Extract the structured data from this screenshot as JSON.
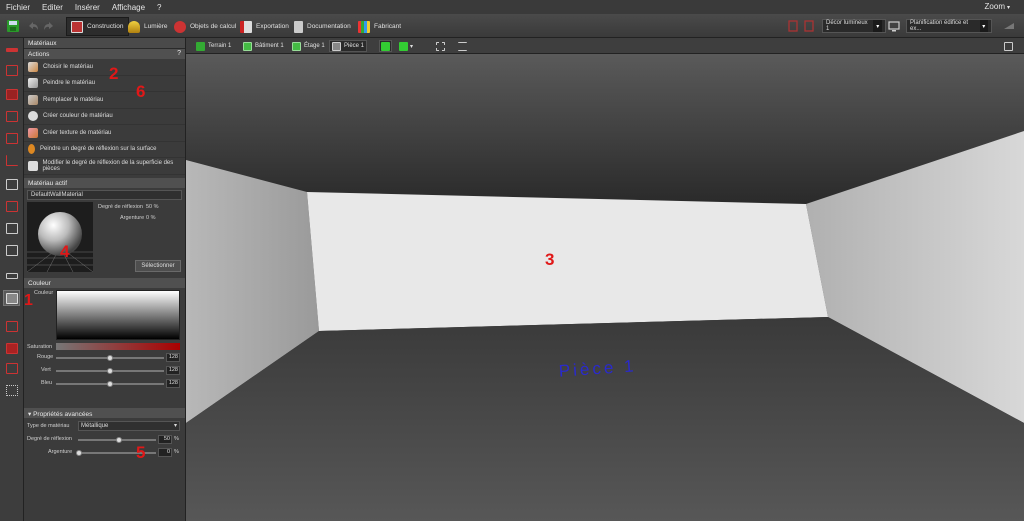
{
  "menu": {
    "items": [
      "Fichier",
      "Editer",
      "Insérer",
      "Affichage",
      "?"
    ],
    "zoom": "Zoom"
  },
  "toolbar": {
    "tabs": [
      "Construction",
      "Lumière",
      "Objets de calcul",
      "Exportation",
      "Documentation",
      "Fabricant"
    ],
    "active_tab": "Construction",
    "scene_dropdown": "Décor lumineux 1",
    "planning_dropdown": "Planification édifice et ex..."
  },
  "panel": {
    "title": "Matériaux",
    "actions_header": "Actions",
    "help": "?",
    "actions": [
      "Choisir le matériau",
      "Peindre le matériau",
      "Remplacer le matériau",
      "Créer couleur de matériau",
      "Créer texture de matériau",
      "Peindre un degré de réflexion sur la surface",
      "Modifier le degré de réflexion de la superficie des pièces"
    ],
    "active_material_header": "Matériau actif",
    "material_name": "DefaultWallMaterial",
    "reflection_label": "Degré de réflexion",
    "reflection_value": "50 %",
    "silver_label": "Argenture",
    "silver_value": "0 %",
    "select_button": "Sélectionner",
    "color_header": "Couleur",
    "color_label": "Couleur",
    "saturation_label": "Saturation",
    "rgb": [
      {
        "label": "Rouge",
        "value": "128"
      },
      {
        "label": "Vert",
        "value": "128"
      },
      {
        "label": "Bleu",
        "value": "128"
      }
    ],
    "advanced_header": "Propriétés avancées",
    "material_type_label": "Type de matériau",
    "material_type_value": "Métallique",
    "adv_reflection_label": "Degré de réflexion",
    "adv_reflection_value": "50",
    "adv_silver_label": "Argenture",
    "adv_silver_value": "0",
    "percent": "%"
  },
  "viewbar": {
    "crumbs": [
      "Terrain 1",
      "Bâtiment 1",
      "Étage 1",
      "Pièce 1"
    ],
    "active": "Pièce 1"
  },
  "viewport": {
    "room_label": "Pièce 1"
  },
  "annotations": [
    "1",
    "2",
    "3",
    "4",
    "5",
    "6"
  ]
}
